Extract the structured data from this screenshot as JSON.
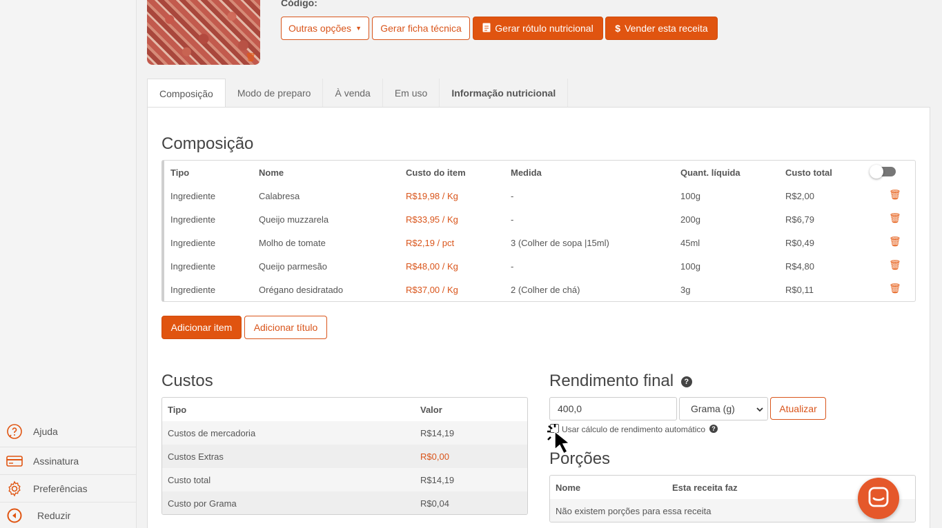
{
  "sidebar": {
    "items": [
      {
        "label": "Ajuda",
        "icon": "help-circle-icon"
      },
      {
        "label": "Assinatura",
        "icon": "credit-card-icon"
      },
      {
        "label": "Preferências",
        "icon": "gear-icon"
      },
      {
        "label": "Reduzir",
        "icon": "collapse-arrow-icon"
      }
    ]
  },
  "header": {
    "codigo_label": "Código:",
    "buttons": {
      "outras_opcoes": "Outras opções",
      "gerar_ficha": "Gerar ficha técnica",
      "gerar_rotulo": "Gerar rótulo nutricional",
      "vender": "Vender esta receita"
    }
  },
  "tabs": [
    "Composição",
    "Modo de preparo",
    "À venda",
    "Em uso",
    "Informação nutricional"
  ],
  "composicao": {
    "title": "Composição",
    "headers": [
      "Tipo",
      "Nome",
      "Custo do item",
      "Medida",
      "Quant. líquida",
      "Custo total"
    ],
    "rows": [
      {
        "tipo": "Ingrediente",
        "nome": "Calabresa",
        "custo": "R$19,98 / Kg",
        "medida": "-",
        "quant": "100g",
        "total": "R$2,00"
      },
      {
        "tipo": "Ingrediente",
        "nome": "Queijo muzzarela",
        "custo": "R$33,95 / Kg",
        "medida": "-",
        "quant": "200g",
        "total": "R$6,79"
      },
      {
        "tipo": "Ingrediente",
        "nome": "Molho de tomate",
        "custo": "R$2,19 / pct",
        "medida": "3 (Colher de sopa |15ml)",
        "quant": "45ml",
        "total": "R$0,49"
      },
      {
        "tipo": "Ingrediente",
        "nome": "Queijo parmesão",
        "custo": "R$48,00 / Kg",
        "medida": "-",
        "quant": "100g",
        "total": "R$4,80"
      },
      {
        "tipo": "Ingrediente",
        "nome": "Orégano desidratado",
        "custo": "R$37,00 / Kg",
        "medida": "2 (Colher de chá)",
        "quant": "3g",
        "total": "R$0,11"
      }
    ],
    "add_item": "Adicionar item",
    "add_title": "Adicionar título"
  },
  "custos": {
    "title": "Custos",
    "headers": [
      "Tipo",
      "Valor"
    ],
    "rows": [
      {
        "tipo": "Custos de mercadoria",
        "valor": "R$14,19"
      },
      {
        "tipo": "Custos Extras",
        "valor": "R$0,00"
      },
      {
        "tipo": "Custo total",
        "valor": "R$14,19"
      },
      {
        "tipo": "Custo por Grama",
        "valor": "R$0,04"
      }
    ]
  },
  "rendimento": {
    "title": "Rendimento final",
    "value": "400,0",
    "unit": "Grama (g)",
    "update": "Atualizar",
    "auto_label": "Usar cálculo de rendimento automático"
  },
  "porcoes": {
    "title": "Porções",
    "headers": [
      "Nome",
      "Esta receita faz"
    ],
    "empty": "Não existem porções para essa receita"
  },
  "colors": {
    "accent": "#e05410"
  }
}
